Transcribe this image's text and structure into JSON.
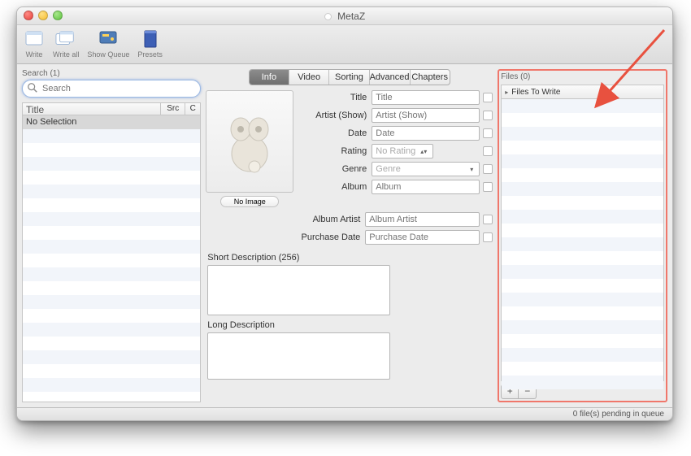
{
  "window": {
    "title": "MetaZ"
  },
  "toolbar": {
    "write": "Write",
    "write_all": "Write all",
    "show_queue": "Show Queue",
    "presets": "Presets"
  },
  "left": {
    "heading": "Search (1)",
    "search_placeholder": "Search",
    "columns": {
      "title": "Title",
      "src": "Src",
      "c": "C"
    },
    "no_selection": "No Selection"
  },
  "tabs": {
    "info": "Info",
    "video": "Video",
    "sorting": "Sorting",
    "advanced": "Advanced",
    "chapters": "Chapters"
  },
  "artwork": {
    "no_image": "No Image"
  },
  "fields": {
    "title": {
      "label": "Title",
      "placeholder": "Title"
    },
    "artist_show": {
      "label": "Artist (Show)",
      "placeholder": "Artist (Show)"
    },
    "date": {
      "label": "Date",
      "placeholder": "Date"
    },
    "rating": {
      "label": "Rating",
      "value": "No Rating"
    },
    "genre": {
      "label": "Genre",
      "value": "Genre"
    },
    "album": {
      "label": "Album",
      "placeholder": "Album"
    },
    "album_artist": {
      "label": "Album Artist",
      "placeholder": "Album Artist"
    },
    "purchase_date": {
      "label": "Purchase Date",
      "placeholder": "Purchase Date"
    },
    "short_desc": "Short Description (256)",
    "long_desc": "Long Description"
  },
  "right": {
    "heading": "Files (0)",
    "files_to_write": "Files To Write"
  },
  "status": {
    "text": "0 file(s) pending in queue"
  }
}
